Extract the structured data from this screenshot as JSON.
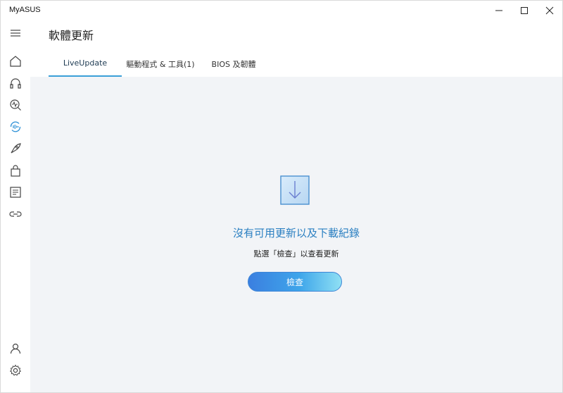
{
  "window": {
    "title": "MyASUS"
  },
  "titlebar": {
    "minimize_icon": "minimize-icon",
    "maximize_icon": "maximize-icon",
    "close_icon": "close-icon"
  },
  "sidebar": {
    "items": [
      {
        "icon": "menu-icon"
      },
      {
        "icon": "home-icon"
      },
      {
        "icon": "headset-icon"
      },
      {
        "icon": "diagnostics-icon"
      },
      {
        "icon": "live-update-icon",
        "active": true
      },
      {
        "icon": "rocket-icon"
      },
      {
        "icon": "shopping-bag-icon"
      },
      {
        "icon": "news-icon"
      },
      {
        "icon": "link-icon"
      },
      {
        "icon": "user-icon"
      },
      {
        "icon": "settings-icon"
      }
    ]
  },
  "header": {
    "page_title": "軟體更新",
    "tabs": [
      {
        "label": "LiveUpdate",
        "active": true
      },
      {
        "label": "驅動程式 & 工具(1)",
        "active": false
      },
      {
        "label": "BIOS 及韌體",
        "active": false
      }
    ]
  },
  "main": {
    "empty_icon": "download-box-icon",
    "empty_title": "沒有可用更新以及下載紀錄",
    "empty_subtitle": "點選「檢查」以查看更新",
    "check_button": "檢查"
  },
  "colors": {
    "accent": "#3a9fd8",
    "title_blue": "#2a7fc1",
    "content_bg": "#f2f4f7",
    "button_start": "#3b7fe0",
    "button_end": "#8fe0f4"
  }
}
